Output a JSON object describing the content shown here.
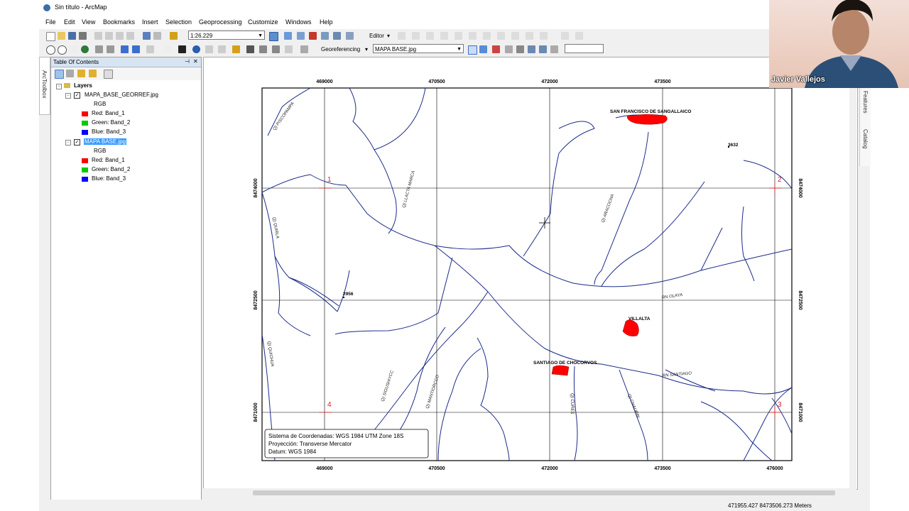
{
  "window": {
    "title": "Sin título - ArcMap"
  },
  "menu": [
    "File",
    "Edit",
    "View",
    "Bookmarks",
    "Insert",
    "Selection",
    "Geoprocessing",
    "Customize",
    "Windows",
    "Help"
  ],
  "toolbar": {
    "scale": "1:26.229",
    "editor_label": "Editor",
    "georef_label": "Georeferencing",
    "georef_layer": "MAPA BASE.jpg"
  },
  "toc": {
    "title": "Table Of Contents",
    "pin_icon": "pin-icon",
    "close_icon": "close-icon",
    "root_label": "Layers",
    "layers": [
      {
        "name": "MAPA_BASE_GEORREF.jpg",
        "checked": true,
        "selected": false,
        "rgb_label": "RGB",
        "bands": [
          {
            "label": "Red:  Band_1",
            "color": "#ff0000"
          },
          {
            "label": "Green: Band_2",
            "color": "#00cc00"
          },
          {
            "label": "Blue:  Band_3",
            "color": "#0000ff"
          }
        ]
      },
      {
        "name": "MAPA BASE.jpg",
        "checked": true,
        "selected": true,
        "rgb_label": "RGB",
        "bands": [
          {
            "label": "Red:  Band_1",
            "color": "#ff0000"
          },
          {
            "label": "Green: Band_2",
            "color": "#00cc00"
          },
          {
            "label": "Blue:  Band_3",
            "color": "#0000ff"
          }
        ]
      }
    ]
  },
  "side_tabs": {
    "arctoolbox": "ArcToolbox",
    "features": "Features",
    "catalog": "Catalog"
  },
  "webcam": {
    "name": "Javier Vallejos"
  },
  "map": {
    "x_ticks": [
      "469000",
      "470500",
      "472000",
      "473500",
      "476000"
    ],
    "y_ticks": [
      "8474000",
      "8472500",
      "8471000"
    ],
    "control_points": [
      "1",
      "2",
      "3",
      "4"
    ],
    "top_edge_label": "4",
    "places": {
      "san_francisco": "SAN FRANCISCO DE SANGALLAICO",
      "villalta": "VILLALTA",
      "santiago": "SANTIAGO DE CHOCORVOS",
      "pt_3632": "3632",
      "pt_2956": "2956"
    },
    "rivers": {
      "piscopampa": "Q) PISCOPAMPA",
      "llactamarca": "Q) LLACTA MARCA",
      "aracocha": "Q) ARACOCHA",
      "quirla": "Q) QUIRLA",
      "olaya": "RN OLAYA",
      "quichua": "Q) QUICHUA",
      "sigushiycc": "Q) SIGUSHIYCC",
      "mantiorcco": "Q) MANTIORCCO",
      "cures": "Q) CURES",
      "chaurin": "Q) CHAURIN",
      "santiago": "RN SANTIAGO"
    },
    "legend": [
      "Sistema de Coordenadas: WGS 1984 UTM Zone 18S",
      "Proyección: Transverse Mercator",
      "Datum: WGS 1984"
    ]
  },
  "status": {
    "coordinates": "471955.427  8473506.273 Meters"
  }
}
